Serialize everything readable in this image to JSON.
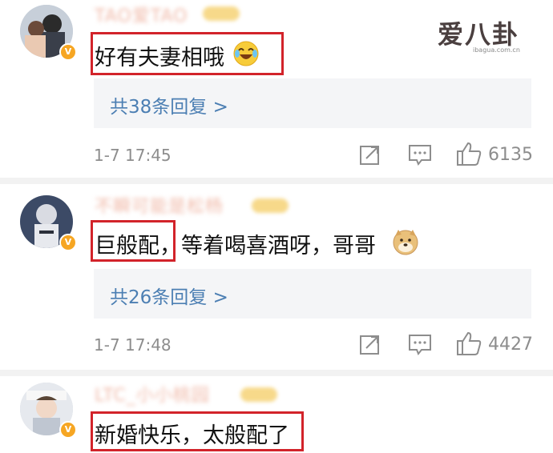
{
  "watermark": {
    "title": "爱八卦",
    "url": "ibagua.com.cn"
  },
  "comments": [
    {
      "username": "TAO爱TAO",
      "text": "好有夫妻相哦",
      "emoji": "laughing-tears-emoji",
      "replies_label": "共38条回复 >",
      "time": "1-7 17:45",
      "likes": "6135"
    },
    {
      "username": "不瞬可能是松杨",
      "text": "巨般配，等着喝喜酒呀，哥哥",
      "emoji": "doge-emoji",
      "replies_label": "共26条回复 >",
      "time": "1-7 17:48",
      "likes": "4427"
    },
    {
      "username": "LTC_小小桃园",
      "text": "新婚快乐，太般配了",
      "emoji": "",
      "replies_label": "",
      "time": "",
      "likes": ""
    }
  ],
  "colors": {
    "highlight_border": "#d2232a",
    "reply_link": "#4c7fb3",
    "verified_badge": "#f6a623"
  }
}
